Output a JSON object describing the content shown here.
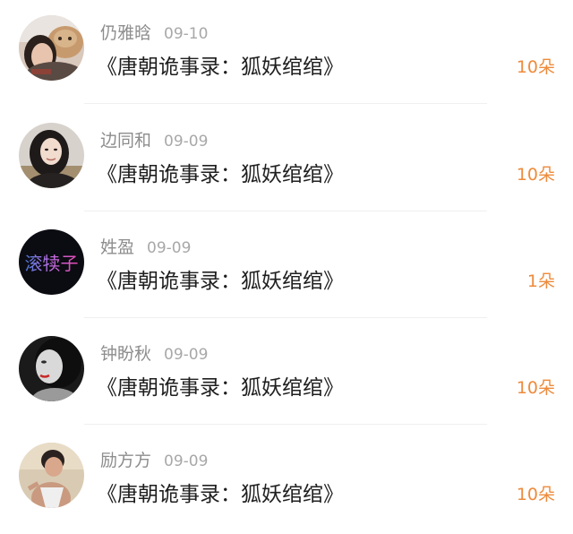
{
  "list": [
    {
      "user": "仍雅晗",
      "date": "09-10",
      "title": "《唐朝诡事录：狐妖绾绾》",
      "gift": "10朵",
      "avatar": "avatar-girl-with-cat"
    },
    {
      "user": "边同和",
      "date": "09-09",
      "title": "《唐朝诡事录：狐妖绾绾》",
      "gift": "10朵",
      "avatar": "avatar-woman-portrait"
    },
    {
      "user": "姓盈",
      "date": "09-09",
      "title": "《唐朝诡事录：狐妖绾绾》",
      "gift": "1朵",
      "avatar": "avatar-text-logo",
      "avatar_text": "滚犊子"
    },
    {
      "user": "钟盼秋",
      "date": "09-09",
      "title": "《唐朝诡事录：狐妖绾绾》",
      "gift": "10朵",
      "avatar": "avatar-bw-woman-portrait"
    },
    {
      "user": "励方方",
      "date": "09-09",
      "title": "《唐朝诡事录：狐妖绾绾》",
      "gift": "10朵",
      "avatar": "avatar-man-in-tank-top"
    }
  ],
  "colors": {
    "gift_count": "#ed8b3c",
    "meta_text": "#9b9b9b",
    "title_text": "#1f1f1f",
    "divider": "#efefef"
  }
}
